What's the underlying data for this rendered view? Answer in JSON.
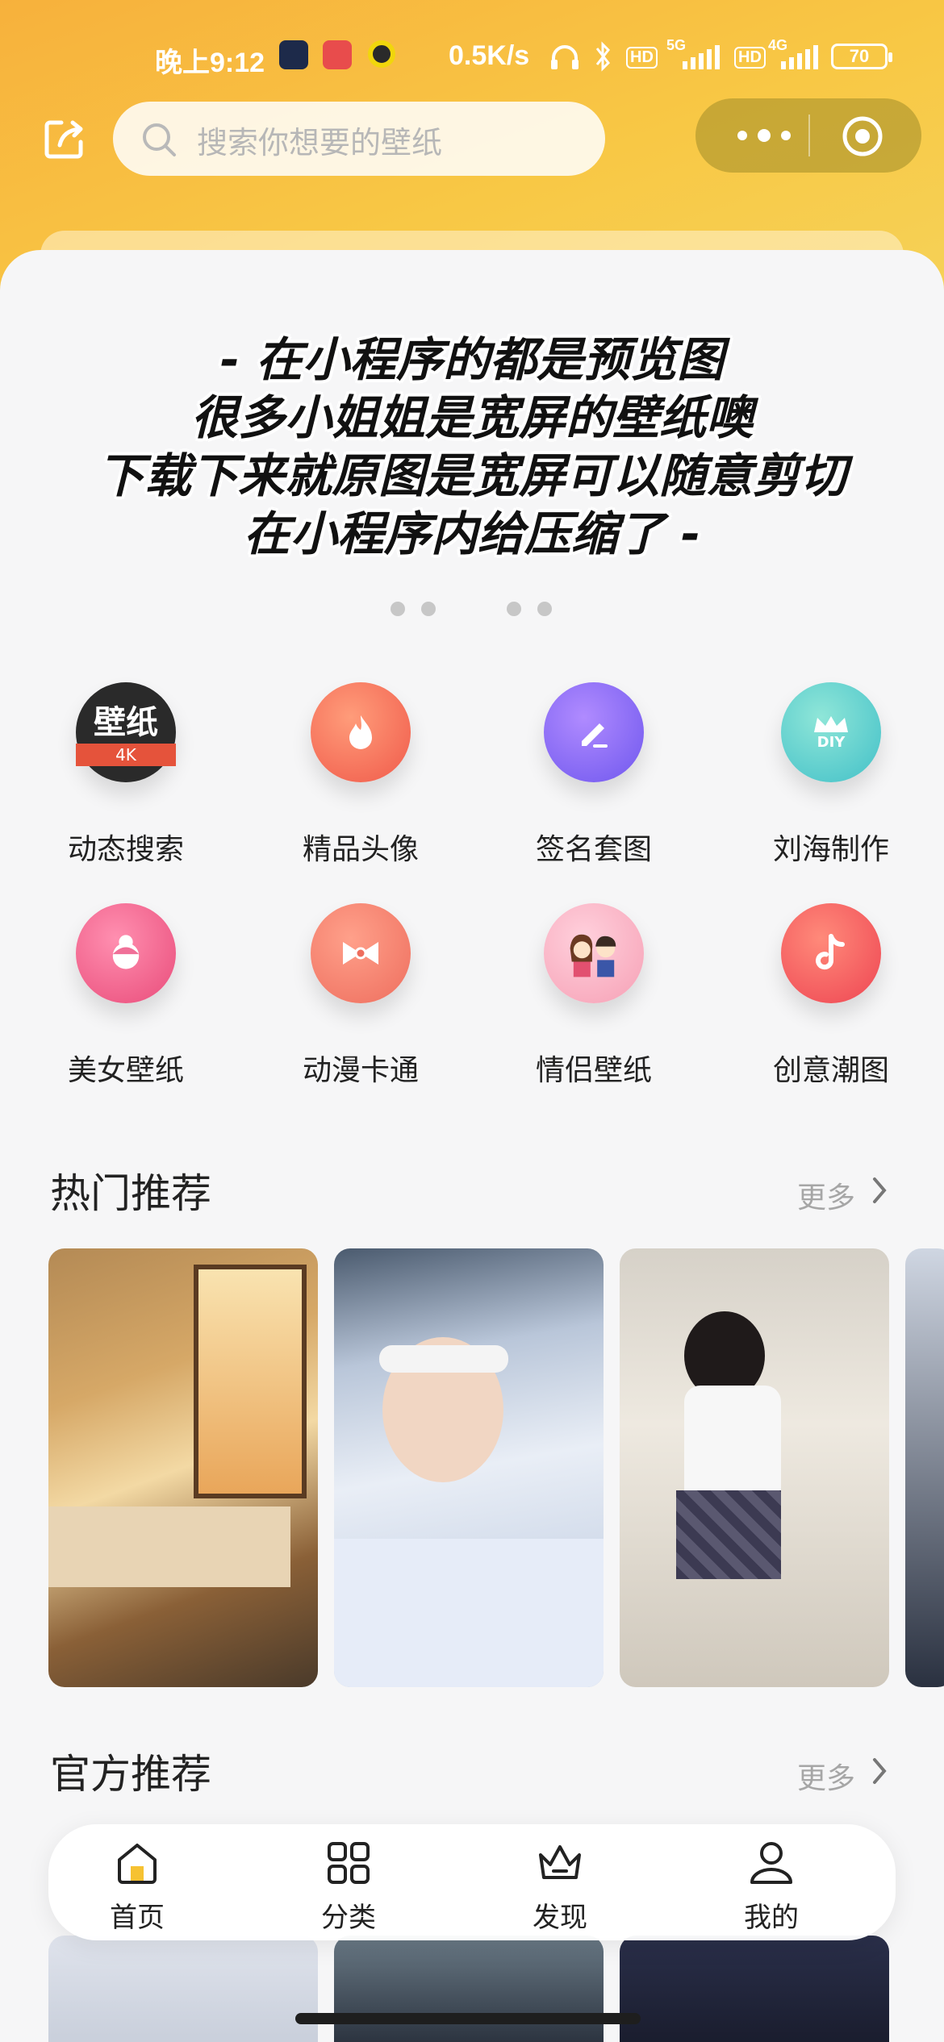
{
  "status_bar": {
    "time": "晚上9:12",
    "network_speed": "0.5K/s",
    "sim1_type": "5G",
    "sim2_type": "4G",
    "hd1": "HD",
    "hd2": "HD",
    "battery": "70"
  },
  "header": {
    "search_placeholder": "搜索你想要的壁纸"
  },
  "banner": {
    "lines": [
      "- 在小程序的都是预览图",
      "很多小姐姐是宽屏的壁纸噢",
      "下载下来就原图是宽屏可以随意剪切",
      "在小程序内给压缩了 -"
    ]
  },
  "badge": {
    "wallpaper_big": "壁纸",
    "wallpaper_small": "4K",
    "diy": "DIY"
  },
  "categories": [
    {
      "label": "动态搜索",
      "icon": "wallpaper-4k-icon",
      "color": "#2a2a2a"
    },
    {
      "label": "精品头像",
      "icon": "flame-icon",
      "color": "#f26b5a"
    },
    {
      "label": "签名套图",
      "icon": "pen-icon",
      "color": "#8a6cf3"
    },
    {
      "label": "刘海制作",
      "icon": "crown-diy-icon",
      "color": "#5fd3c5"
    },
    {
      "label": "美女壁纸",
      "icon": "girl-face-icon",
      "color": "#f0608a"
    },
    {
      "label": "动漫卡通",
      "icon": "bow-icon",
      "color": "#f07c6a"
    },
    {
      "label": "情侣壁纸",
      "icon": "couple-icon",
      "color": "#f6a0b5"
    },
    {
      "label": "创意潮图",
      "icon": "music-note-icon",
      "color": "#f2525c"
    }
  ],
  "sections": {
    "hot": {
      "title": "热门推荐",
      "more": "更多"
    },
    "official": {
      "title": "官方推荐",
      "more": "更多"
    }
  },
  "tabs": [
    {
      "label": "首页",
      "icon": "home-icon",
      "active": true
    },
    {
      "label": "分类",
      "icon": "grid-icon",
      "active": false
    },
    {
      "label": "发现",
      "icon": "crown-icon",
      "active": false
    },
    {
      "label": "我的",
      "icon": "user-icon",
      "active": false
    }
  ],
  "colors": {
    "header_gradient_start": "#f7b13c",
    "header_gradient_end": "#f5d35a",
    "active_tab": "#f6c232"
  }
}
